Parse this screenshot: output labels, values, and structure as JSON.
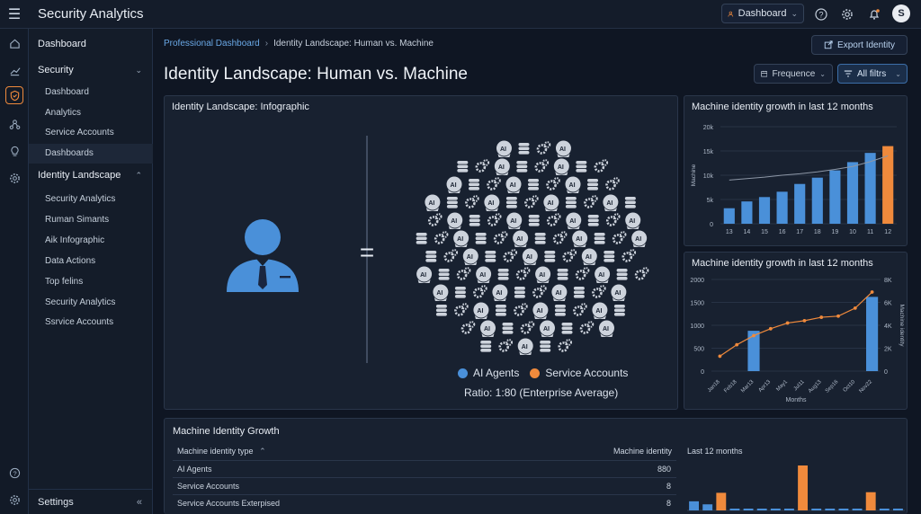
{
  "app": {
    "title": "Security Analytics",
    "dashboard_select": "Dashboard",
    "avatar_initial": "S"
  },
  "sidebar": {
    "dashboard": "Dashboard",
    "security": "Security",
    "security_items": [
      "Dashboard",
      "Analytics",
      "Service Accounts",
      "Dashboards"
    ],
    "identity_landscape": "Identity Landscape",
    "identity_items": [
      "Security Analytics",
      "Ruman Simants",
      "Aik Infographic",
      "Data Actions",
      "Top felins",
      "Security Analytics",
      "Ssrvice Accounts"
    ],
    "settings": "Settings"
  },
  "breadcrumb": {
    "link": "Professional Dashboard",
    "current": "Identity Landscape: Human vs. Machine"
  },
  "header": {
    "export": "Export Identity",
    "title": "Identity Landscape: Human vs. Machine",
    "frequency": "Frequence",
    "filters": "All filtrs"
  },
  "infographic": {
    "title": "Identity Landscape: Infographic",
    "equals": "=",
    "legend": [
      {
        "label": "AI Agents",
        "color": "#4a90d9"
      },
      {
        "label": "Service Accounts",
        "color": "#f08a3c"
      }
    ],
    "ratio": "Ratio: 1:80 (Enterprise Average)",
    "ai_label": "AI"
  },
  "colors": {
    "blue": "#4a90d9",
    "orange": "#f08a3c",
    "grey_icon": "#cdd3dc"
  },
  "chart_data": [
    {
      "type": "bar",
      "title": "Machine identity growth in last 12 months",
      "ylabel": "Machine",
      "categories": [
        "13",
        "14",
        "15",
        "16",
        "17",
        "18",
        "19",
        "10",
        "11",
        "12"
      ],
      "values": [
        3200,
        4600,
        5500,
        6600,
        8200,
        9500,
        11000,
        12700,
        14600,
        16000
      ],
      "highlight_last": true,
      "trend": [
        9000,
        9300,
        9600,
        10000,
        10300,
        10700,
        11200,
        11800,
        12800,
        14000
      ],
      "yticks": [
        "0",
        "5k",
        "10k",
        "15k",
        "20k"
      ],
      "ylim": [
        0,
        20000
      ]
    },
    {
      "type": "bar+line",
      "title": "Machine identity growth in last 12 months",
      "xlabel": "Months",
      "ylabel_right": "Machine identity",
      "categories": [
        "Jan18",
        "Feb18",
        "Mar13",
        "Apr13",
        "May1",
        "Jul11",
        "Aug13",
        "Sep16",
        "Oct10",
        "Nov22"
      ],
      "bar_values": [
        0,
        0,
        880,
        0,
        0,
        0,
        0,
        0,
        0,
        1620
      ],
      "line_values": [
        1300,
        2300,
        3100,
        3700,
        4200,
        4400,
        4700,
        4800,
        5500,
        6900
      ],
      "yticks_left": [
        "0",
        "500",
        "1000",
        "1500",
        "2000"
      ],
      "yticks_right": [
        "0",
        "2K",
        "4K",
        "6K",
        "8K"
      ],
      "ylim_left": [
        0,
        2000
      ],
      "ylim_right": [
        0,
        8000
      ]
    },
    {
      "type": "bar",
      "title": "Last 12 months",
      "values": [
        150,
        100,
        290,
        0,
        0,
        0,
        30,
        0,
        740,
        0,
        0,
        0,
        0,
        300,
        0,
        30
      ],
      "colors": [
        "#4a90d9",
        "#4a90d9",
        "#f08a3c",
        "#4a90d9",
        "#4a90d9",
        "#4a90d9",
        "#4a90d9",
        "#4a90d9",
        "#f08a3c",
        "#4a90d9",
        "#4a90d9",
        "#4a90d9",
        "#4a90d9",
        "#f08a3c",
        "#4a90d9",
        "#4a90d9"
      ]
    }
  ],
  "table": {
    "title": "Machine Identity Growth",
    "headers": [
      "Machine identity type",
      "Machine identity",
      "Last 12 months"
    ],
    "rows": [
      {
        "type": "AI Agents",
        "count": "880"
      },
      {
        "type": "Service Accounts",
        "count": "8"
      },
      {
        "type": "Service Accounts Exterpised",
        "count": "8"
      }
    ]
  }
}
